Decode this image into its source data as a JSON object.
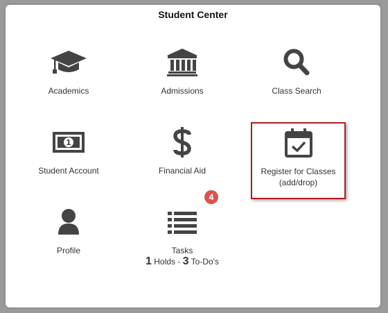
{
  "panel": {
    "title": "Student Center"
  },
  "tiles": [
    {
      "label": "Academics",
      "icon": "graduation-cap-icon"
    },
    {
      "label": "Admissions",
      "icon": "institution-building-icon"
    },
    {
      "label": "Class Search",
      "icon": "magnifier-icon"
    },
    {
      "label": "Student Account",
      "icon": "money-bill-icon"
    },
    {
      "label": "Financial Aid",
      "icon": "dollar-sign-icon"
    },
    {
      "label_line1": "Register for Classes",
      "label_line2": "(add/drop)",
      "icon": "calendar-check-icon",
      "highlighted": true
    },
    {
      "label": "Profile",
      "icon": "user-icon"
    },
    {
      "label": "Tasks",
      "icon": "list-icon",
      "badge": "4",
      "holds_count": "1",
      "holds_text": "Holds",
      "separator": "-",
      "todos_count": "3",
      "todos_text": "To-Do's"
    }
  ],
  "colors": {
    "icon": "#444444",
    "highlight_border": "#b01c22",
    "badge": "#d9534f"
  }
}
